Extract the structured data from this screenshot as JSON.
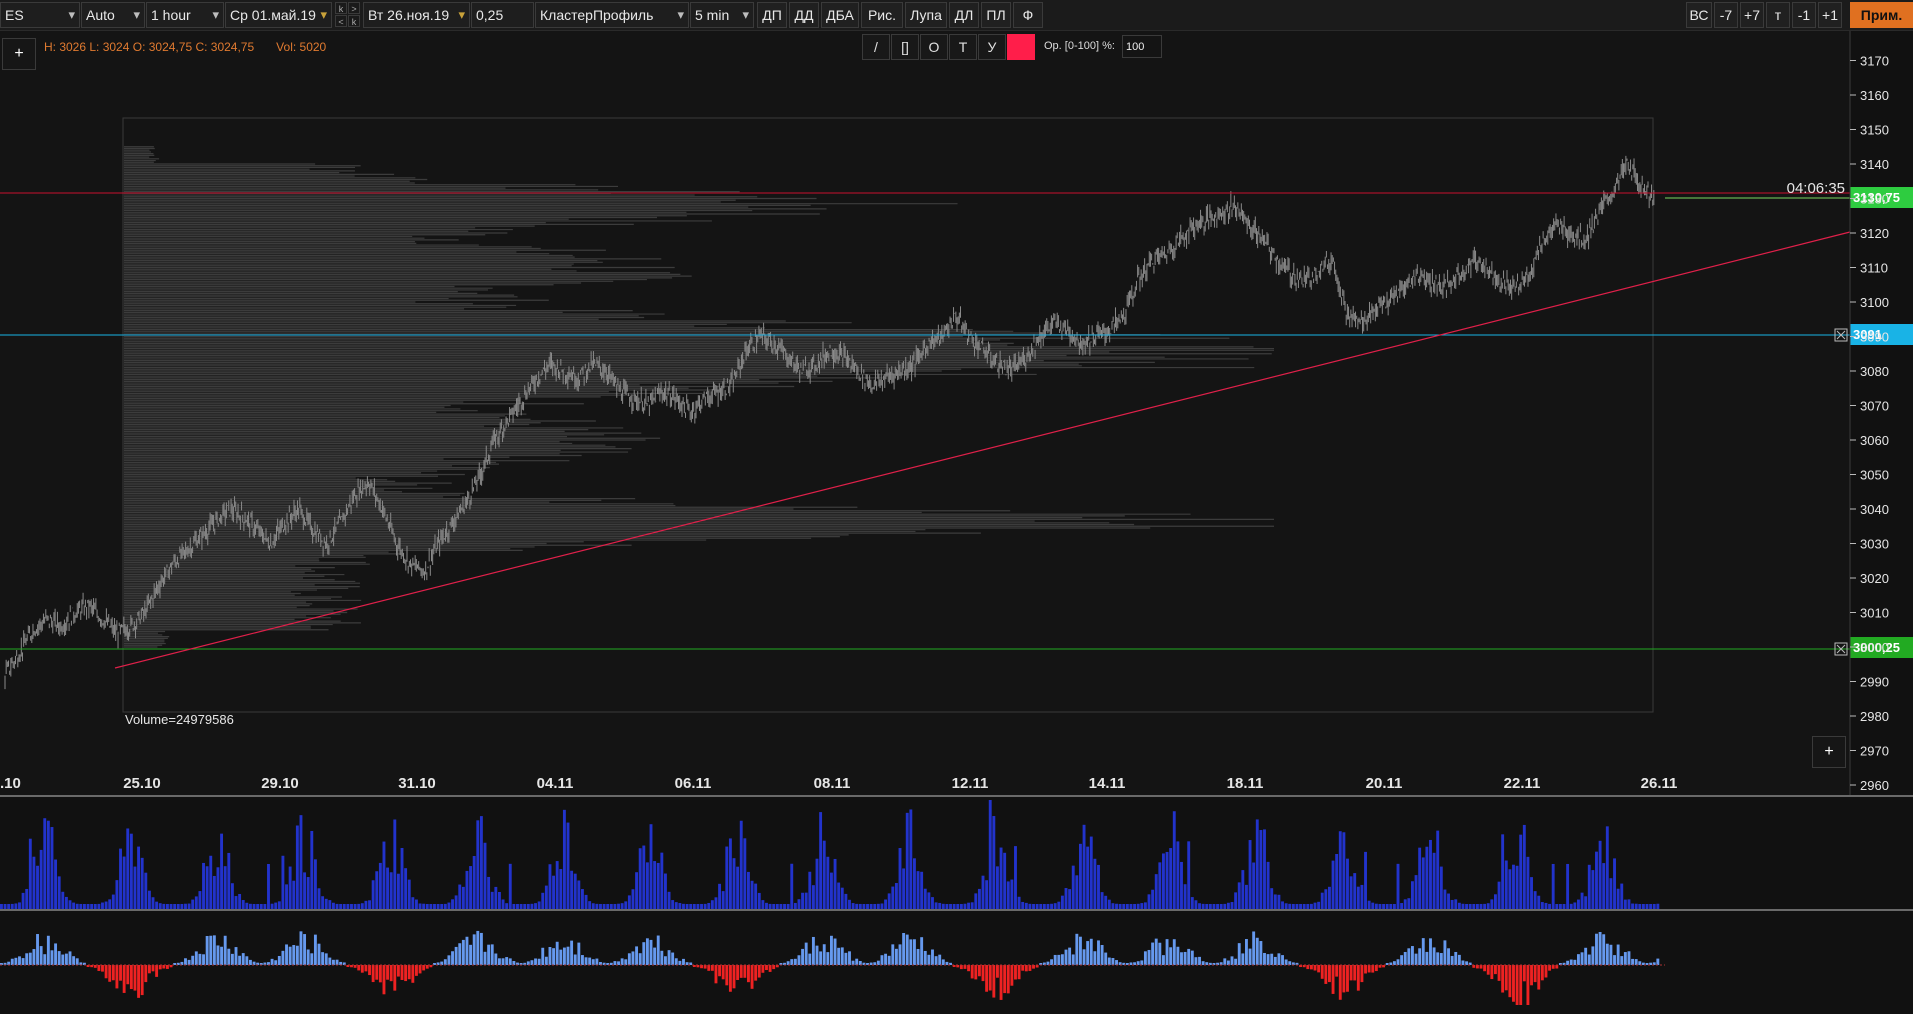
{
  "toolbar": {
    "symbol": "ES",
    "scale_mode": "Auto",
    "timeframe": "1 hour",
    "start_date": "Ср 01.май.19",
    "nav_k_top": "k",
    "nav_gt": ">",
    "nav_lt": "<",
    "nav_k_bottom": "k",
    "end_date": "Вт 26.ноя.19",
    "tick_size": "0,25",
    "chart_type": "КластерПрофиль",
    "cluster_timeframe": "5 min",
    "btn_dp": "ДП",
    "btn_dd": "ДД",
    "btn_dba": "ДБА",
    "btn_ris": "Рис.",
    "btn_lupa": "Лупа",
    "btn_dl": "ДЛ",
    "btn_pl": "ПЛ",
    "btn_f": "Ф",
    "btn_vs": "ВС",
    "btn_m7": "-7",
    "btn_p7": "+7",
    "btn_t": "т",
    "btn_m1": "-1",
    "btn_p1": "+1",
    "btn_apply": "Прим."
  },
  "info": {
    "plus": "+",
    "ohlc": "H: 3026 L: 3024 O: 3024,75 C: 3024,75",
    "volume": "Vol: 5020",
    "plus_bottom": "+"
  },
  "drawing_tools": {
    "line": "/",
    "rect": "[]",
    "circle": "O",
    "text": "T",
    "other": "У",
    "opacity_label": "Ор. [0-100] %:",
    "opacity_value": "100",
    "color": "#ff1e4a"
  },
  "chart": {
    "profile_volume_label": "Volume=24979586",
    "countdown": "04:06:35",
    "price_labels": [
      {
        "text": "3130,75",
        "color": "#2ecc40"
      },
      {
        "text": "3091",
        "color": "#19b3e6"
      },
      {
        "text": "3000,25",
        "color": "#22aa22"
      }
    ],
    "line_colors": {
      "red_level": "#c8102e",
      "blue_level": "#19b3e6",
      "green_level": "#22aa22",
      "trend": "#e0204a",
      "up_bar": "#2233cc",
      "delta_pos": "#6699ee",
      "delta_neg": "#ee2222"
    }
  },
  "chart_data": {
    "type": "line",
    "title": "",
    "xlabel": "",
    "ylabel": "",
    "ylim": [
      2960,
      3175
    ],
    "y_ticks": [
      "3170",
      "3160",
      "3150",
      "3140",
      "3130",
      "3120",
      "3110",
      "3100",
      "3090",
      "3080",
      "3070",
      "3060",
      "3050",
      "3040",
      "3030",
      "3020",
      "3010",
      "3000",
      "2990",
      "2980",
      "2970",
      "2960"
    ],
    "x_ticks": [
      ".10",
      "25.10",
      "29.10",
      "31.10",
      "04.11",
      "06.11",
      "08.11",
      "12.11",
      "14.11",
      "18.11",
      "20.11",
      "22.11",
      "26.11"
    ],
    "levels": [
      3128,
      3091,
      3000.25
    ],
    "last_price": 3130.75,
    "series": [
      {
        "values": [
          2992,
          2998,
          3005,
          3008,
          3006,
          3010,
          3012,
          3008,
          3004,
          3006,
          3010,
          3018,
          3024,
          3028,
          3032,
          3036,
          3040,
          3038,
          3034,
          3030,
          3036,
          3040,
          3034,
          3030,
          3036,
          3044,
          3048,
          3040,
          3030,
          3024,
          3022,
          3030,
          3036,
          3042,
          3050,
          3060,
          3066,
          3072,
          3078,
          3082,
          3080,
          3078,
          3082,
          3080,
          3074,
          3072,
          3070,
          3074,
          3072,
          3068,
          3072,
          3074,
          3076,
          3086,
          3090,
          3088,
          3084,
          3080,
          3082,
          3086,
          3084,
          3080,
          3076,
          3078,
          3080,
          3082,
          3088,
          3090,
          3096,
          3090,
          3086,
          3082,
          3080,
          3084,
          3090,
          3094,
          3092,
          3088,
          3090,
          3092,
          3096,
          3106,
          3112,
          3114,
          3118,
          3122,
          3124,
          3126,
          3128,
          3122,
          3118,
          3112,
          3108,
          3106,
          3110,
          3112,
          3096,
          3094,
          3098,
          3100,
          3104,
          3108,
          3106,
          3104,
          3108,
          3112,
          3110,
          3106,
          3104,
          3108,
          3118,
          3122,
          3120,
          3118,
          3126,
          3132,
          3140,
          3134,
          3130
        ]
      }
    ]
  }
}
